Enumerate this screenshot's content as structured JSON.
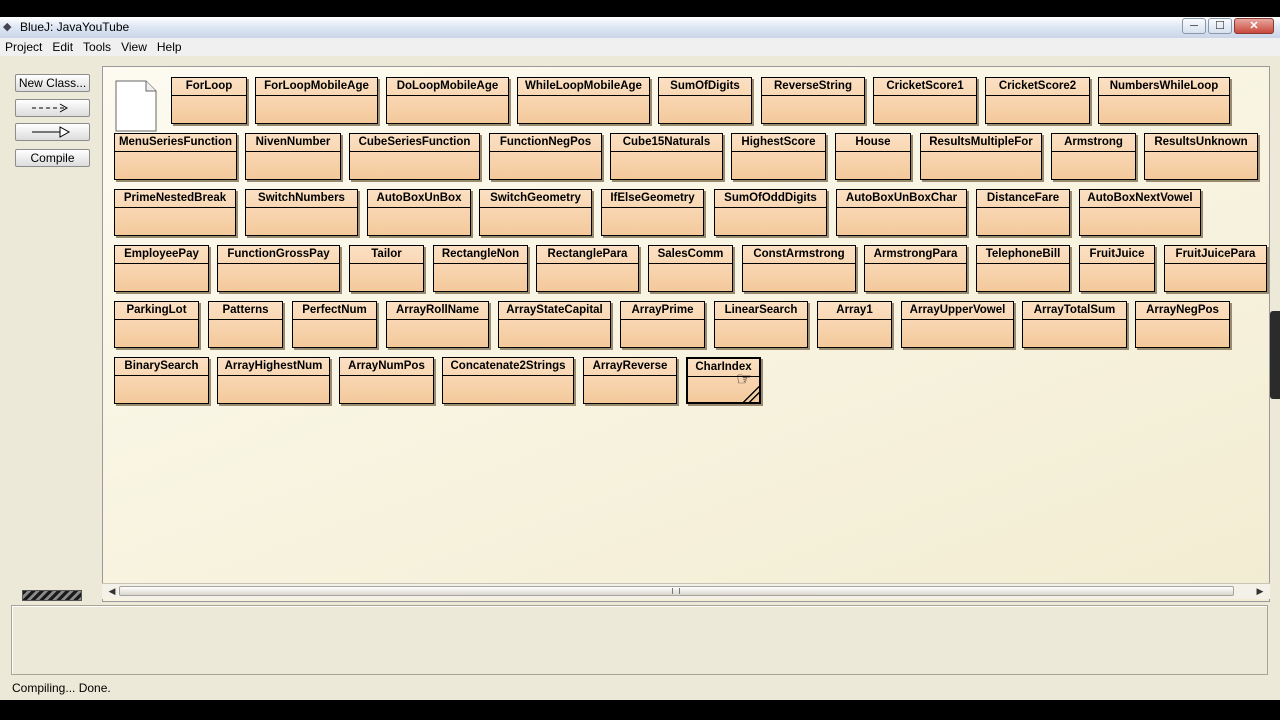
{
  "window": {
    "title": "BlueJ:  JavaYouTube",
    "minimize": "─",
    "maximize": "☐",
    "close": "✕",
    "app_icon": "bluej-icon"
  },
  "menu": [
    "Project",
    "Edit",
    "Tools",
    "View",
    "Help"
  ],
  "toolbar": {
    "new_class": "New Class...",
    "dependency_arrow": "- - ->",
    "inheritance_arrow": "—▷",
    "compile": "Compile"
  },
  "classes": [
    "ForLoop",
    "ForLoopMobileAge",
    "DoLoopMobileAge",
    "WhileLoopMobileAge",
    "SumOfDigits",
    "ReverseString",
    "CricketScore1",
    "CricketScore2",
    "NumbersWhileLoop",
    "MenuSeriesFunction",
    "NivenNumber",
    "CubeSeriesFunction",
    "FunctionNegPos",
    "Cube15Naturals",
    "HighestScore",
    "House",
    "ResultsMultipleFor",
    "Armstrong",
    "ResultsUnknown",
    "PrimeNestedBreak",
    "SwitchNumbers",
    "AutoBoxUnBox",
    "SwitchGeometry",
    "IfElseGeometry",
    "SumOfOddDigits",
    "AutoBoxUnBoxChar",
    "DistanceFare",
    "AutoBoxNextVowel",
    "EmployeePay",
    "FunctionGrossPay",
    "Tailor",
    "RectangleNon",
    "RectanglePara",
    "SalesComm",
    "ConstArmstrong",
    "ArmstrongPara",
    "TelephoneBill",
    "FruitJuice",
    "FruitJuicePara",
    "ParkingLot",
    "Patterns",
    "PerfectNum",
    "ArrayRollName",
    "ArrayStateCapital",
    "ArrayPrime",
    "LinearSearch",
    "Array1",
    "ArrayUpperVowel",
    "ArrayTotalSum",
    "ArrayNegPos",
    "BinarySearch",
    "ArrayHighestNum",
    "ArrayNumPos",
    "Concatenate2Strings",
    "ArrayReverse",
    "CharIndex"
  ],
  "selected_class": "CharIndex",
  "status": "Compiling... Done."
}
